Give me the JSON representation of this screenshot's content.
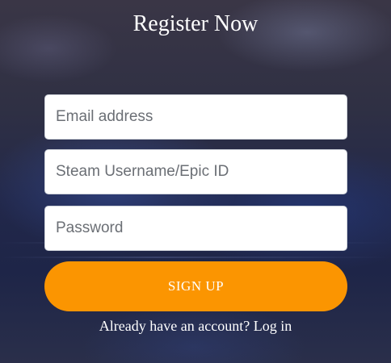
{
  "form": {
    "title": "Register Now",
    "email_placeholder": "Email address",
    "steam_placeholder": "Steam Username/Epic ID",
    "password_placeholder": "Password",
    "signup_label": "SIGN UP",
    "login_prompt": "Already have an account?",
    "login_link": "Log in"
  },
  "colors": {
    "accent": "#fb9501",
    "text_on_dark": "#ffffff",
    "background": "#2a2d48"
  }
}
